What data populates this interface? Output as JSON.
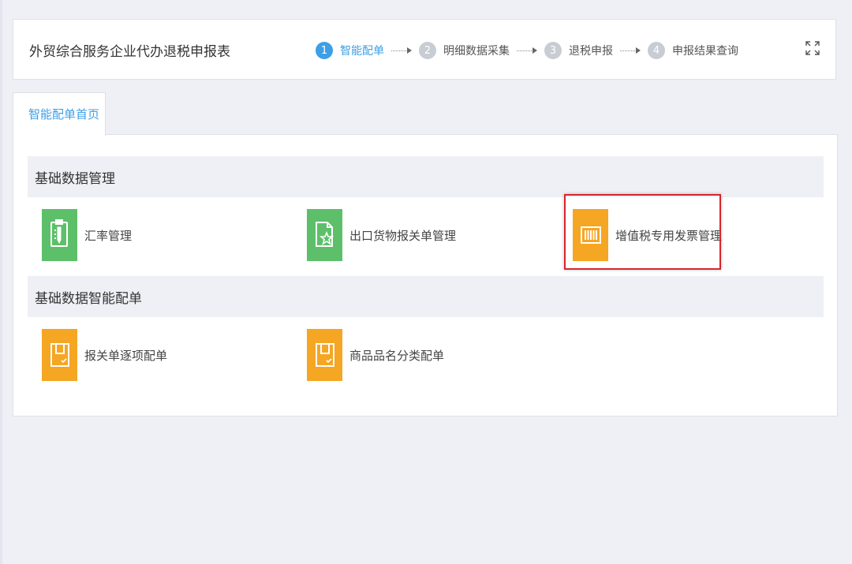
{
  "header": {
    "title": "外贸综合服务企业代办退税申报表",
    "steps": [
      {
        "number": "1",
        "label": "智能配单"
      },
      {
        "number": "2",
        "label": "明细数据采集"
      },
      {
        "number": "3",
        "label": "退税申报"
      },
      {
        "number": "4",
        "label": "申报结果查询"
      }
    ],
    "active_step": 1
  },
  "tabs": [
    {
      "label": "智能配单首页"
    }
  ],
  "sections": [
    {
      "title": "基础数据管理",
      "items": [
        {
          "label": "汇率管理",
          "icon": "clipboard-pen-icon",
          "color": "#5dbf6a"
        },
        {
          "label": "出口货物报关单管理",
          "icon": "document-star-icon",
          "color": "#5dbf6a"
        },
        {
          "label": "增值税专用发票管理",
          "icon": "barcode-invoice-icon",
          "color": "#f5a623"
        }
      ]
    },
    {
      "title": "基础数据智能配单",
      "items": [
        {
          "label": "报关单逐项配单",
          "icon": "tray-check-icon",
          "color": "#f5a623"
        },
        {
          "label": "商品品名分类配单",
          "icon": "tray-check-icon",
          "color": "#f5a623"
        }
      ]
    }
  ],
  "colors": {
    "accent": "#3d9fe6",
    "green": "#5dbf6a",
    "orange": "#f5a623",
    "highlight": "#d8262c",
    "background": "#eef0f5"
  }
}
